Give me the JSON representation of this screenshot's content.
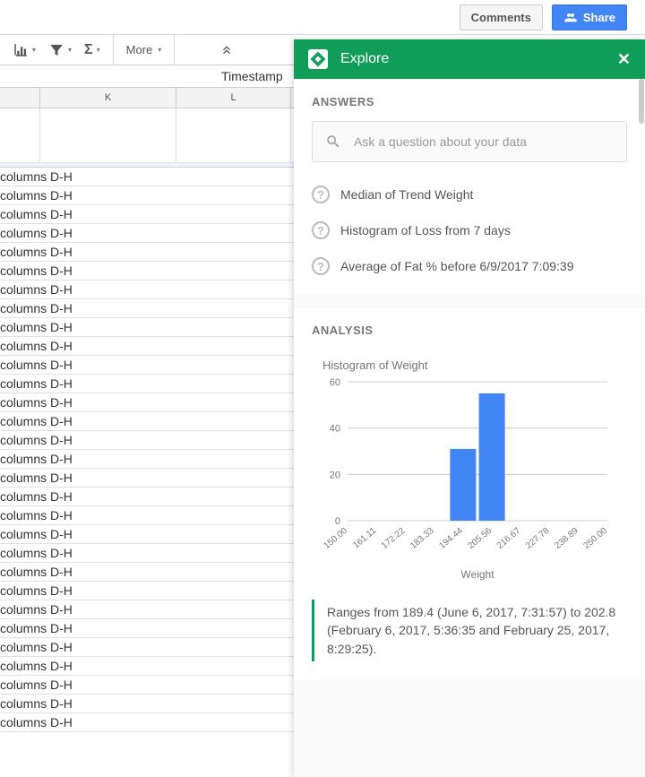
{
  "topbar": {
    "comments": "Comments",
    "share": "Share"
  },
  "toolbar": {
    "more": "More"
  },
  "formula_bar": {
    "value": "Timestamp"
  },
  "columns": {
    "a": "",
    "k": "K",
    "l": "L"
  },
  "rows": {
    "text": "columns D-H",
    "count": 30
  },
  "explore": {
    "title": "Explore",
    "answers_label": "ANSWERS",
    "search_placeholder": "Ask a question about your data",
    "suggestions": [
      "Median of Trend Weight",
      "Histogram of Loss from 7 days",
      "Average of Fat % before 6/9/2017 7:09:39"
    ],
    "analysis_label": "ANALYSIS",
    "chart_title": "Histogram of Weight",
    "note": "Ranges from 189.4 (June 6, 2017, 7:31:57) to 202.8 (February 6, 2017, 5:36:35 and February 25, 2017, 8:29:25)."
  },
  "chart_data": {
    "type": "bar",
    "title": "Histogram of Weight",
    "xlabel": "Weight",
    "ylabel": "",
    "categories": [
      "150.00",
      "161.11",
      "172.22",
      "183.33",
      "194.44",
      "205.56",
      "216.67",
      "227.78",
      "238.89",
      "250.00"
    ],
    "values": [
      0,
      0,
      0,
      0,
      31,
      55,
      0,
      0,
      0,
      0
    ],
    "ylim": [
      0,
      60
    ],
    "yticks": [
      0,
      20,
      40,
      60
    ]
  }
}
